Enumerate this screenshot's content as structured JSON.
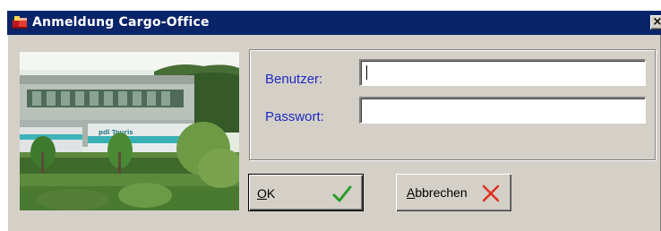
{
  "window": {
    "title": "Anmeldung Cargo-Office",
    "app_icon": "cargo-office-icon",
    "close_label": "×",
    "colors": {
      "titlebar": "#0a246a",
      "face": "#d4d0c8",
      "label": "#1f2bbf"
    }
  },
  "photo": {
    "icon": "company-building-photo",
    "truck_label": "pdl Touris"
  },
  "form": {
    "user_label": "Benutzer:",
    "user_value": "",
    "password_label": "Passwort:",
    "password_value": ""
  },
  "buttons": {
    "ok": {
      "mnemonic": "O",
      "rest": "K",
      "icon": "checkmark-icon"
    },
    "cancel": {
      "mnemonic": "A",
      "rest": "bbrechen",
      "icon": "cross-icon"
    }
  }
}
